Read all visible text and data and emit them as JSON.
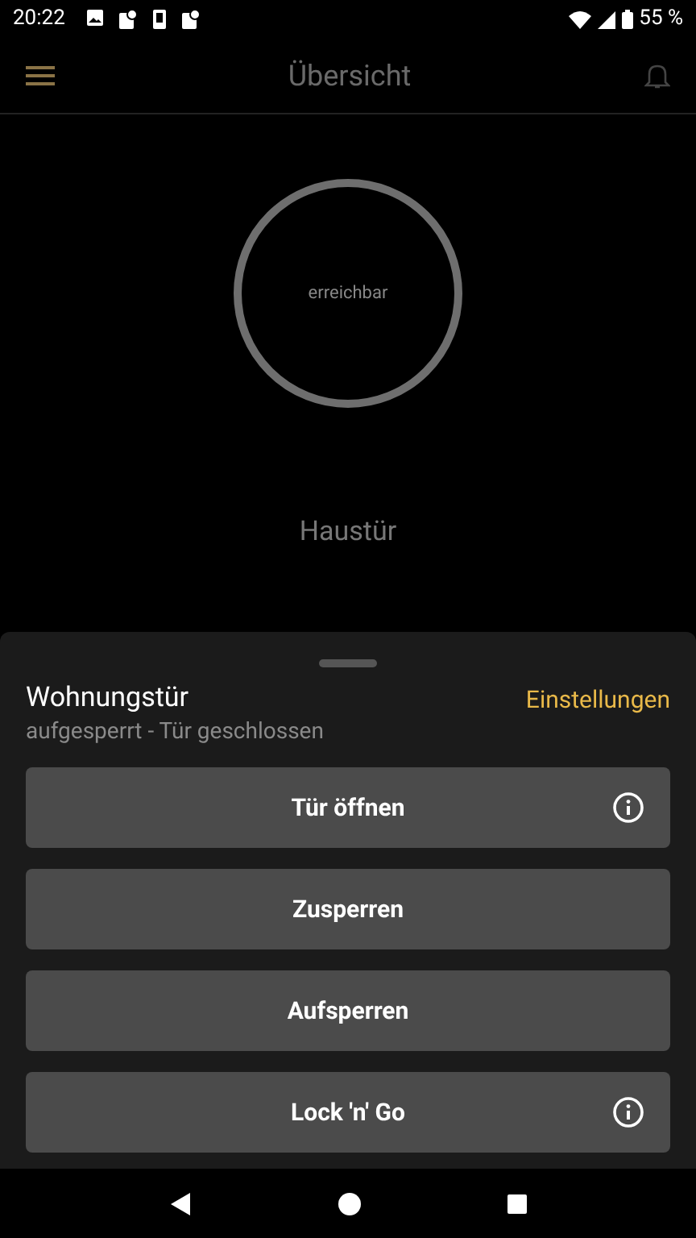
{
  "status_bar": {
    "time": "20:22",
    "battery": "55 %"
  },
  "app_bar": {
    "title": "Übersicht"
  },
  "device": {
    "status": "erreichbar",
    "name": "Haustür"
  },
  "sheet": {
    "title": "Wohnungstür",
    "subtitle": "aufgesperrt - Tür geschlossen",
    "settings_link": "Einstellungen",
    "buttons": [
      {
        "label": "Tür öffnen",
        "info": true
      },
      {
        "label": "Zusperren",
        "info": false
      },
      {
        "label": "Aufsperren",
        "info": false
      },
      {
        "label": "Lock 'n' Go",
        "info": true
      }
    ]
  }
}
